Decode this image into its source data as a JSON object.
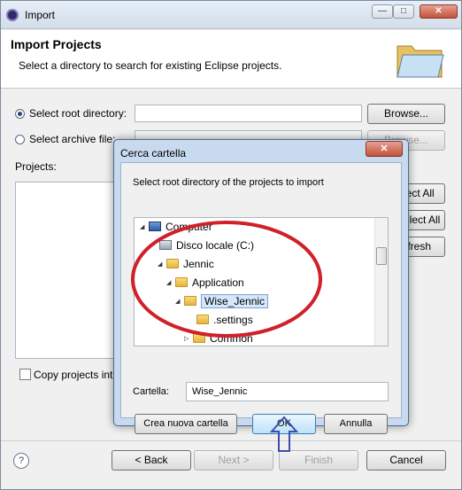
{
  "window": {
    "title": "Import",
    "minimize": "—",
    "maximize": "□",
    "close": "✕"
  },
  "header": {
    "title": "Import Projects",
    "description": "Select a directory to search for existing Eclipse projects.",
    "icon": "folder-icon"
  },
  "options": {
    "root_label": "Select root directory:",
    "root_value": "",
    "root_browse": "Browse...",
    "archive_label": "Select archive file:",
    "archive_browse": "Browse..."
  },
  "projects": {
    "label": "Projects:",
    "select_all": "Select All",
    "deselect_all": "Deselect All",
    "refresh": "Refresh",
    "copy_label": "Copy projects into workspace"
  },
  "footer": {
    "back": "< Back",
    "next": "Next >",
    "finish": "Finish",
    "cancel": "Cancel",
    "help_icon": "help-icon"
  },
  "dialog": {
    "title": "Cerca cartella",
    "close": "✕",
    "instruction": "Select root directory of the projects to import",
    "tree": [
      {
        "label": "Computer",
        "icon": "computer-icon",
        "expanded": true
      },
      {
        "label": "Disco locale (C:)",
        "icon": "drive-icon",
        "expanded": false
      },
      {
        "label": "Jennic",
        "icon": "folder-icon",
        "expanded": true
      },
      {
        "label": "Application",
        "icon": "folder-icon",
        "expanded": true
      },
      {
        "label": "Wise_Jennic",
        "icon": "folder-icon",
        "expanded": true,
        "selected": true
      },
      {
        "label": ".settings",
        "icon": "folder-icon",
        "expanded": false
      },
      {
        "label": "Common",
        "icon": "folder-icon",
        "expanded": false
      }
    ],
    "folder_label": "Cartella:",
    "folder_value": "Wise_Jennic",
    "new_folder": "Crea nuova cartella",
    "ok": "OK",
    "cancel": "Annulla"
  },
  "annotation": {
    "oval_color": "#d0202a",
    "arrow_color": "#3b4fb0"
  }
}
